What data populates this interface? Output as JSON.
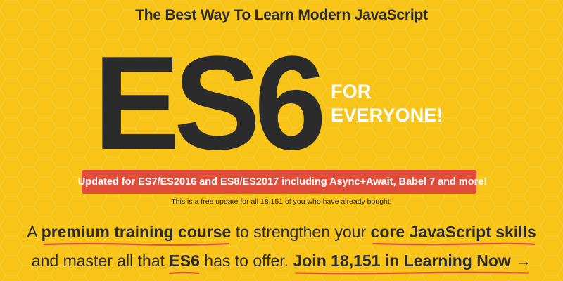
{
  "colors": {
    "background": "#f7c417",
    "text": "#2b2b2b",
    "banner": "#e04d3a",
    "underline": "#e04d3a",
    "hero_accent_text": "#ffffff"
  },
  "header": {
    "tagline": "The Best Way To Learn Modern JavaScript"
  },
  "hero": {
    "logo_text": "ES6",
    "subtitle_line1": "FOR",
    "subtitle_line2": "EVERYONE!"
  },
  "update_banner": {
    "icon": "fire-icon",
    "text": "Updated for ES7/ES2016 and ES8/ES2017 including Async+Await, Babel 7 and more!"
  },
  "free_update_note": "This is a free update for all 18,151 of you who have already bought!",
  "pitch": {
    "line1_a": "A ",
    "line1_hl1": "premium training course",
    "line1_b": " to strengthen your ",
    "line1_hl2": "core JavaScript skills",
    "line2_a": "and master all that ",
    "line2_hl1": "ES6",
    "line2_b": " has to offer. ",
    "cta_label": "Join 18,151 in Learning Now →"
  }
}
